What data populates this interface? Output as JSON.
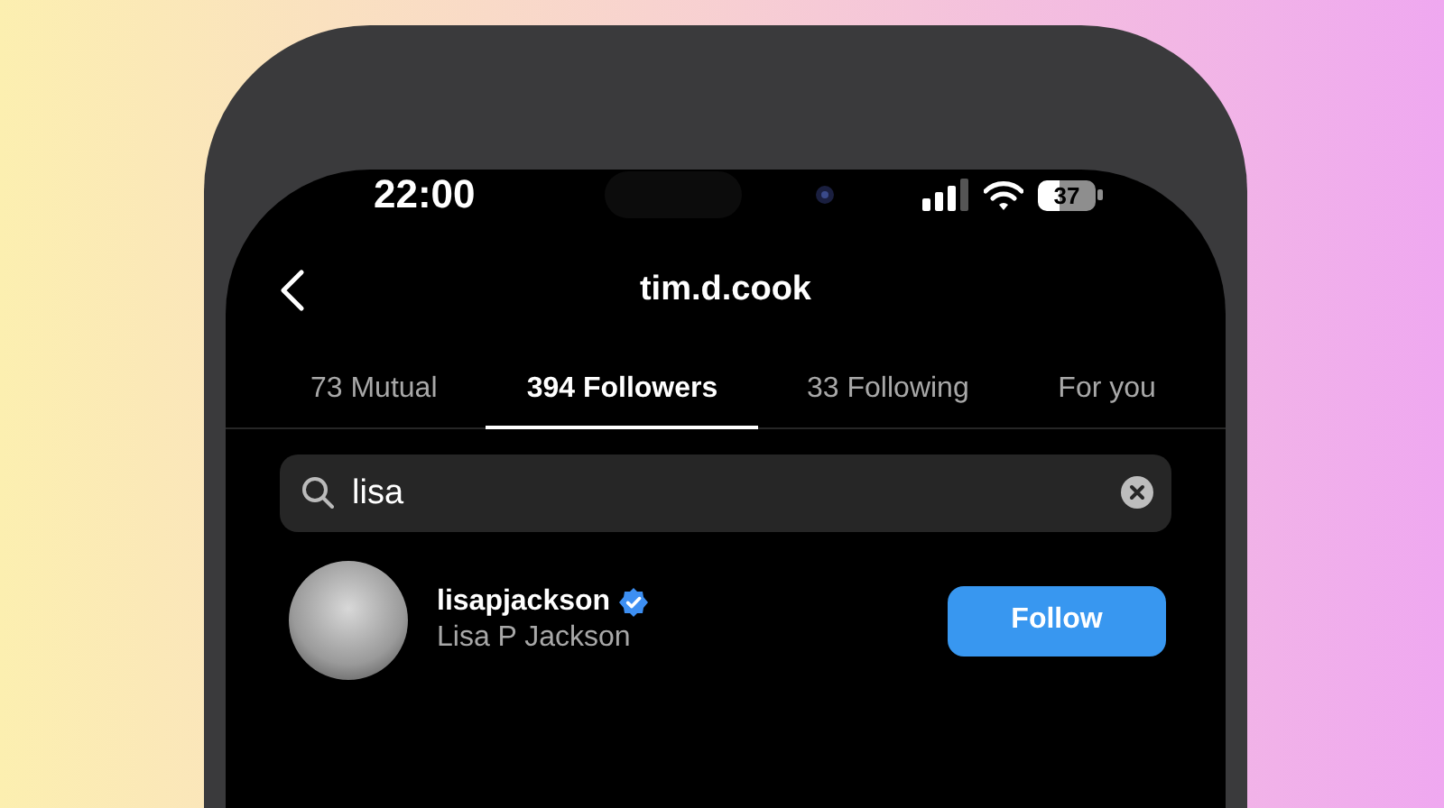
{
  "status_bar": {
    "time": "22:00",
    "battery": "37"
  },
  "header": {
    "title": "tim.d.cook"
  },
  "tabs": [
    {
      "label": "73 Mutual",
      "selected": false
    },
    {
      "label": "394 Followers",
      "selected": true
    },
    {
      "label": "33 Following",
      "selected": false
    },
    {
      "label": "For you",
      "selected": false
    }
  ],
  "search": {
    "value": "lisa"
  },
  "results": [
    {
      "username": "lisapjackson",
      "verified": true,
      "full_name": "Lisa P Jackson",
      "button": "Follow"
    }
  ]
}
